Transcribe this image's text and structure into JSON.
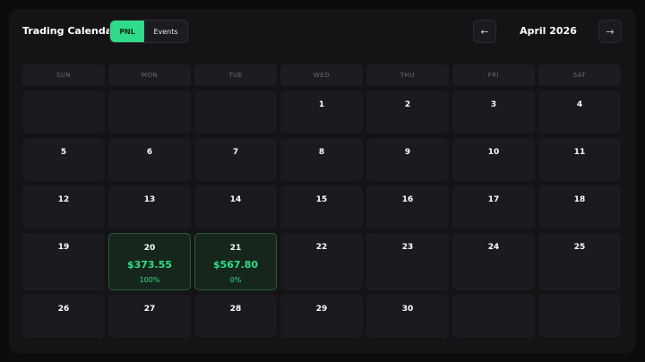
{
  "header": {
    "title": "Trading Calendar",
    "toggle": {
      "pnl_label": "PNL",
      "events_label": "Events",
      "active": "PNL"
    },
    "prev_label": "←",
    "next_label": "→",
    "month": "April 2026"
  },
  "colors": {
    "accent": "#2fdc8a",
    "background": "#0c0c0e",
    "panel": "#141417",
    "cell": "#1b1b1f",
    "profit_cell": "#16261c"
  },
  "calendar": {
    "weekdays": [
      "SUN",
      "MON",
      "TUE",
      "WED",
      "THU",
      "FRI",
      "SAT"
    ],
    "weeks": [
      [
        {
          "day": ""
        },
        {
          "day": ""
        },
        {
          "day": ""
        },
        {
          "day": "1"
        },
        {
          "day": "2"
        },
        {
          "day": "3"
        },
        {
          "day": "4"
        }
      ],
      [
        {
          "day": "5"
        },
        {
          "day": "6"
        },
        {
          "day": "7"
        },
        {
          "day": "8"
        },
        {
          "day": "9"
        },
        {
          "day": "10"
        },
        {
          "day": "11"
        }
      ],
      [
        {
          "day": "12"
        },
        {
          "day": "13"
        },
        {
          "day": "14"
        },
        {
          "day": "15"
        },
        {
          "day": "16"
        },
        {
          "day": "17"
        },
        {
          "day": "18"
        }
      ],
      [
        {
          "day": "19"
        },
        {
          "day": "20",
          "pnl": "$373.55",
          "pct": "100%"
        },
        {
          "day": "21",
          "pnl": "$567.80",
          "pct": "0%"
        },
        {
          "day": "22"
        },
        {
          "day": "23"
        },
        {
          "day": "24"
        },
        {
          "day": "25"
        }
      ],
      [
        {
          "day": "26"
        },
        {
          "day": "27"
        },
        {
          "day": "28"
        },
        {
          "day": "29"
        },
        {
          "day": "30"
        },
        {
          "day": ""
        },
        {
          "day": ""
        }
      ]
    ]
  }
}
